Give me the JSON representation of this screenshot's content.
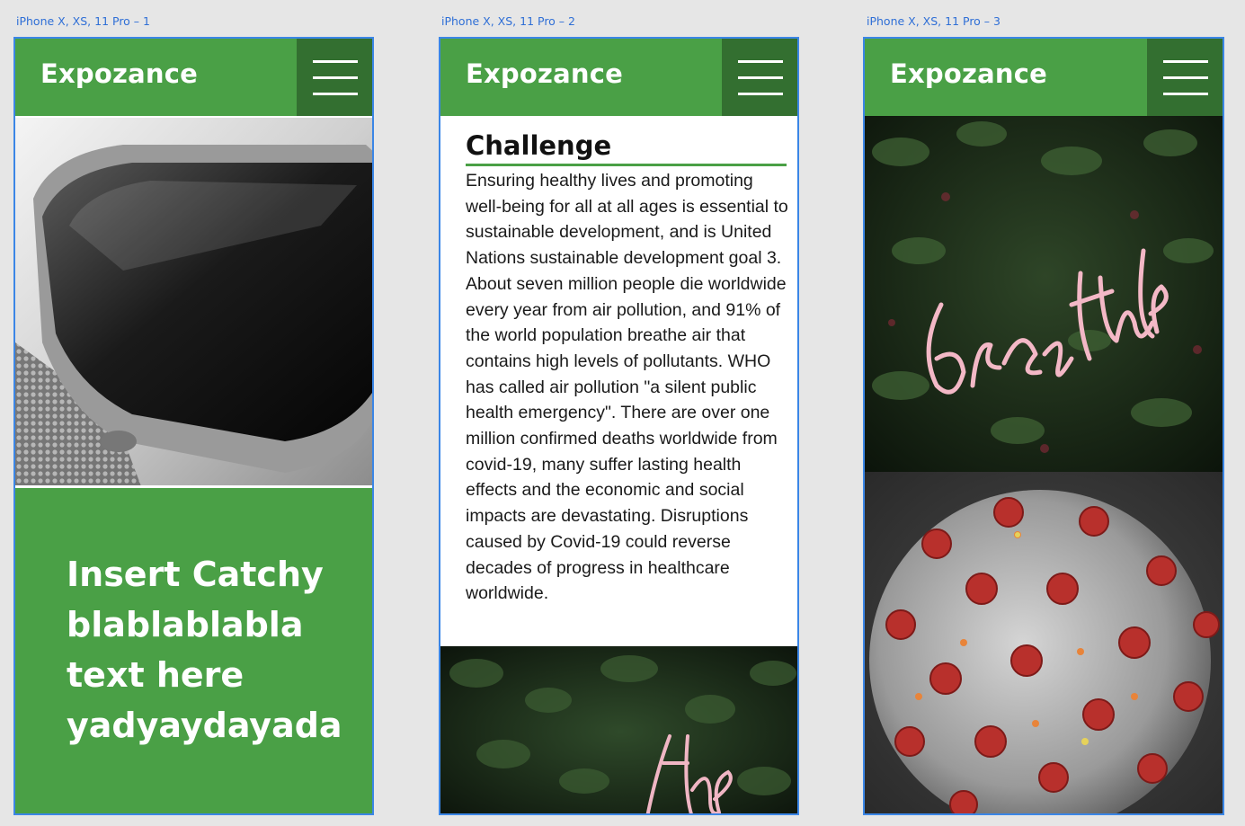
{
  "artboards": [
    {
      "label": "iPhone X, XS, 11 Pro – 1"
    },
    {
      "label": "iPhone X, XS, 11 Pro – 2"
    },
    {
      "label": "iPhone X, XS, 11 Pro – 3"
    }
  ],
  "brand": "Expozance",
  "colors": {
    "primary_green": "#4aa046",
    "menu_dark_green": "#336f30",
    "artboard_border": "#3b86e6"
  },
  "phone1": {
    "hero_image": "smartwatch-photo",
    "catchy_lines": [
      "Insert Catchy",
      "blablablabla",
      "text here",
      "yadyaydayada"
    ]
  },
  "phone2": {
    "heading": "Challenge",
    "body": "Ensuring healthy lives and promoting well-being for all at all ages is essential to sustainable development, and is United Nations sustainable development goal 3. About seven million people die worldwide every year from air pollution, and 91% of the world population breathe air that contains high levels of pollutants. WHO has called air pollution \"a silent public health emergency\". There are over one million confirmed deaths worldwide from covid-19, many suffer lasting health effects and the economic and social impacts are devastating. Disruptions caused by Covid-19 could reverse decades of progress in healthcare worldwide.",
    "bottom_image": "breathe-neon-sign-photo"
  },
  "phone3": {
    "top_image": "breathe-neon-sign-photo",
    "bottom_image": "coronavirus-illustration"
  }
}
